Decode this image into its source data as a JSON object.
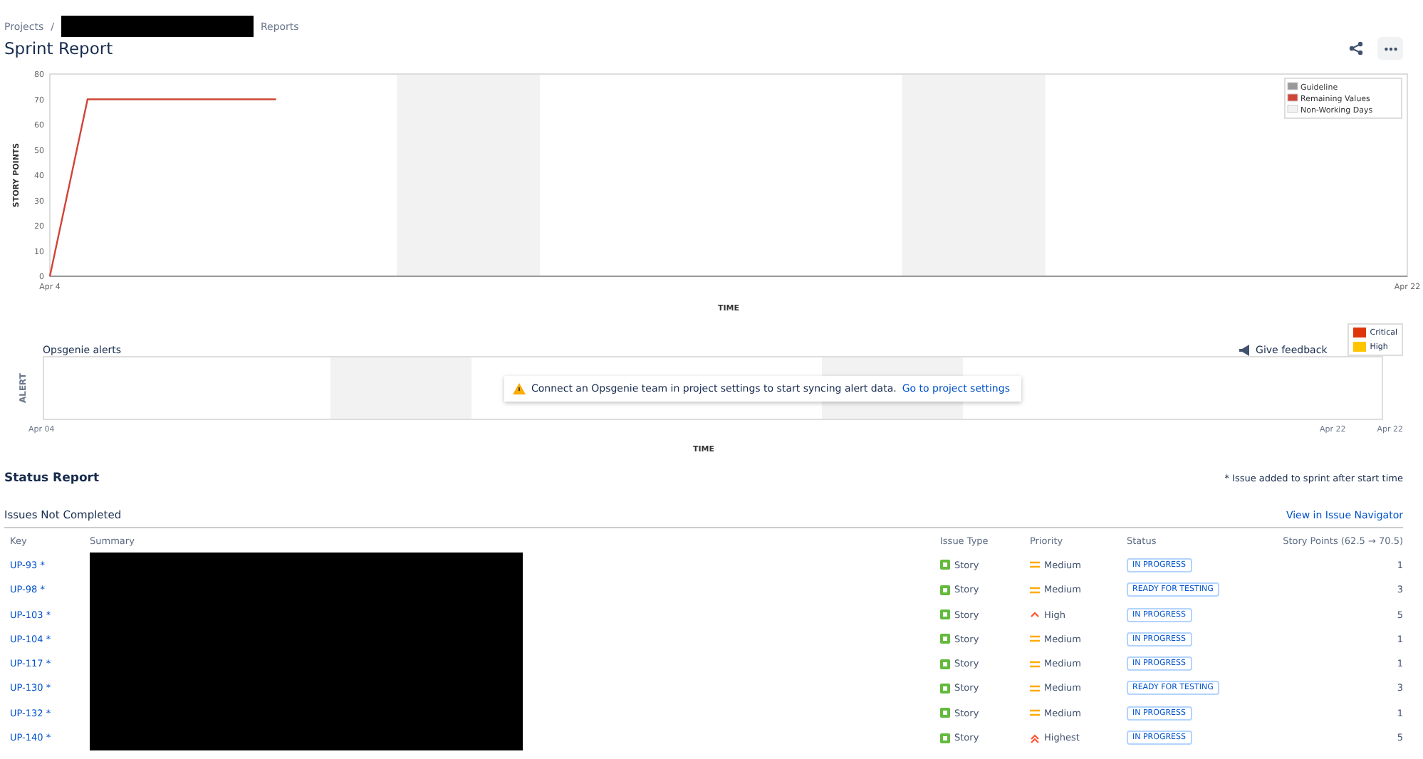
{
  "breadcrumbs": {
    "items": [
      "Projects",
      "Reports"
    ],
    "separator": "/"
  },
  "title": "Sprint Report",
  "burndown": {
    "chart_data": {
      "type": "line",
      "ylabel": "STORY POINTS",
      "xlabel": "TIME",
      "categories": [
        "Apr 4",
        null,
        null,
        null,
        null,
        null,
        null,
        null,
        null,
        null,
        null,
        null,
        null,
        null,
        null,
        null,
        null,
        null,
        null,
        null,
        null,
        null,
        null,
        null,
        null,
        null,
        null,
        null,
        null,
        null,
        null,
        null,
        null,
        null,
        null,
        null,
        "Apr 22"
      ],
      "ylim": [
        0,
        80
      ],
      "yticks": [
        0,
        10,
        20,
        30,
        40,
        50,
        60,
        70,
        80
      ],
      "series": [
        {
          "color": "#d04437",
          "values": [
            0,
            70,
            70,
            70,
            70,
            70,
            70,
            null,
            null,
            null,
            null,
            null,
            null,
            null,
            null,
            null,
            null,
            null,
            null,
            null,
            null,
            null,
            null,
            null,
            null,
            null,
            null,
            null,
            null,
            null,
            null,
            null,
            null,
            null,
            null,
            null,
            null
          ]
        }
      ]
    },
    "legend": [
      {
        "label": "Guideline",
        "color": "#999999"
      },
      {
        "label": "Remaining Values",
        "color": "#d04437"
      },
      {
        "label": "Non-Working Days",
        "color": "#f2f2f2"
      }
    ]
  },
  "opsgenie": {
    "title": "Opsgenie alerts",
    "feedback": "Give feedback",
    "legend": [
      {
        "label": "Critical",
        "color": "#de350b"
      },
      {
        "label": "High",
        "color": "#ffc400"
      }
    ],
    "ylabel": "ALERT",
    "xlabel": "TIME",
    "x_labels": [
      "Apr 04",
      "Apr 22",
      "Apr 22"
    ],
    "notice": "Connect an Opsgenie team in project settings to start syncing alert data.",
    "notice_link": "Go to project settings"
  },
  "status_report": {
    "title": "Status Report",
    "note": "* Issue added to sprint after start time"
  },
  "issues": {
    "title": "Issues Not Completed",
    "link": "View in Issue Navigator",
    "columns": [
      "Key",
      "Summary",
      "Issue Type",
      "Priority",
      "Status",
      "Story Points (62.5 → 70.5)"
    ],
    "rows": [
      {
        "key": "UP-93 *",
        "type": "Story",
        "priority": "Medium",
        "kind": "medium",
        "status": "IN PROGRESS",
        "points": "1"
      },
      {
        "key": "UP-98 *",
        "type": "Story",
        "priority": "Medium",
        "kind": "medium",
        "status": "READY FOR TESTING",
        "points": "3"
      },
      {
        "key": "UP-103 *",
        "type": "Story",
        "priority": "High",
        "kind": "high",
        "status": "IN PROGRESS",
        "points": "5"
      },
      {
        "key": "UP-104 *",
        "type": "Story",
        "priority": "Medium",
        "kind": "medium",
        "status": "IN PROGRESS",
        "points": "1"
      },
      {
        "key": "UP-117 *",
        "type": "Story",
        "priority": "Medium",
        "kind": "medium",
        "status": "IN PROGRESS",
        "points": "1"
      },
      {
        "key": "UP-130 *",
        "type": "Story",
        "priority": "Medium",
        "kind": "medium",
        "status": "READY FOR TESTING",
        "points": "3"
      },
      {
        "key": "UP-132 *",
        "type": "Story",
        "priority": "Medium",
        "kind": "medium",
        "status": "IN PROGRESS",
        "points": "1"
      },
      {
        "key": "UP-140 *",
        "type": "Story",
        "priority": "Highest",
        "kind": "highest",
        "status": "IN PROGRESS",
        "points": "5"
      }
    ]
  }
}
